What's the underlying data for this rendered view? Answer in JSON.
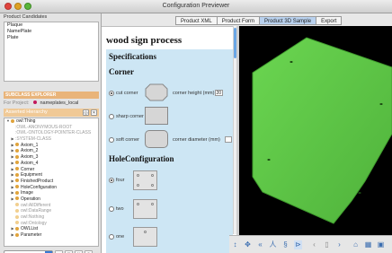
{
  "window": {
    "title": "Configuration Previewer"
  },
  "product_candidates": {
    "header": "Product Candidates",
    "items": [
      "Plaque",
      "NamePlate",
      "Plate"
    ]
  },
  "explorer": {
    "title": "SUBCLASS EXPLORER",
    "project_label": "For Project:",
    "project_value": "nameplates_local",
    "hierarchy_label": "Asserted Hierarchy",
    "tree": [
      {
        "label": "owl:Thing",
        "expander": "▼",
        "dot": "yellow",
        "indent": 0
      },
      {
        "label": ":OWL-ANONYMOUS-ROOT",
        "expander": "",
        "dot": "none",
        "indent": 1,
        "gray": true
      },
      {
        "label": ":OWL-ONTOLOGY-POINTER-CLASS",
        "expander": "",
        "dot": "none",
        "indent": 1,
        "gray": true
      },
      {
        "label": ":SYSTEM-CLASS",
        "expander": "▶",
        "dot": "none",
        "indent": 1,
        "gray": true
      },
      {
        "label": "Axiom_1",
        "expander": "▶",
        "dot": "yellow",
        "indent": 1
      },
      {
        "label": "Axiom_2",
        "expander": "▶",
        "dot": "yellow",
        "indent": 1
      },
      {
        "label": "Axiom_3",
        "expander": "▶",
        "dot": "yellow",
        "indent": 1
      },
      {
        "label": "Axiom_4",
        "expander": "▶",
        "dot": "yellow",
        "indent": 1
      },
      {
        "label": "Corner",
        "expander": "▶",
        "dot": "yellow",
        "indent": 1
      },
      {
        "label": "Equipment",
        "expander": "▶",
        "dot": "yellow",
        "indent": 1
      },
      {
        "label": "FinishedProduct",
        "expander": "▶",
        "dot": "yellow",
        "indent": 1
      },
      {
        "label": "HoleConfiguration",
        "expander": "▶",
        "dot": "yellow",
        "indent": 1
      },
      {
        "label": "Image",
        "expander": "▶",
        "dot": "yellow",
        "indent": 1
      },
      {
        "label": "Operation",
        "expander": "▶",
        "dot": "yellow",
        "indent": 1
      },
      {
        "label": "owl:AllDifferent",
        "expander": "",
        "dot": "light",
        "indent": 1,
        "gray": true
      },
      {
        "label": "owl:DataRange",
        "expander": "",
        "dot": "light",
        "indent": 1,
        "gray": true
      },
      {
        "label": "owl:Nothing",
        "expander": "",
        "dot": "light",
        "indent": 1,
        "gray": true
      },
      {
        "label": "owl:Ontology",
        "expander": "",
        "dot": "light",
        "indent": 1,
        "gray": true
      },
      {
        "label": "OWLList",
        "expander": "▶",
        "dot": "yellow",
        "indent": 1
      },
      {
        "label": "Parameter",
        "expander": "▶",
        "dot": "yellow",
        "indent": 1
      }
    ]
  },
  "tabs": [
    {
      "label": "Product XML",
      "active": false
    },
    {
      "label": "Product Form",
      "active": false
    },
    {
      "label": "Product 3D Sample",
      "active": true
    },
    {
      "label": "Export",
      "active": false
    }
  ],
  "form": {
    "title": "wood sign process",
    "specifications": "Specifications",
    "corner_heading": "Corner",
    "corner_options": [
      {
        "label": "cut corner",
        "selected": true
      },
      {
        "label": "sharp corner",
        "selected": false
      },
      {
        "label": "soft corner",
        "selected": false
      }
    ],
    "corner_height_label": "corner height (mm)",
    "corner_height_value": "20",
    "corner_diameter_label": "corner diameter (mm)",
    "corner_diameter_value": "",
    "hole_heading": "HoleConfiguration",
    "hole_options": [
      {
        "label": "four",
        "selected": true
      },
      {
        "label": "two",
        "selected": false
      },
      {
        "label": "one",
        "selected": false
      }
    ]
  },
  "colors": {
    "plate_green": "#5fc948",
    "spec_bg": "#cde6f4",
    "active_tab": "#b9d1ee",
    "explorer_accent": "#e9b47a"
  },
  "icons": {
    "nav": [
      "pan-icon",
      "move-icon",
      "rotate-left-icon",
      "walk-icon",
      "fly-icon",
      "zoom-icon",
      "previous-icon",
      "next-icon",
      "home-icon",
      "grid-icon",
      "view-icon"
    ]
  }
}
